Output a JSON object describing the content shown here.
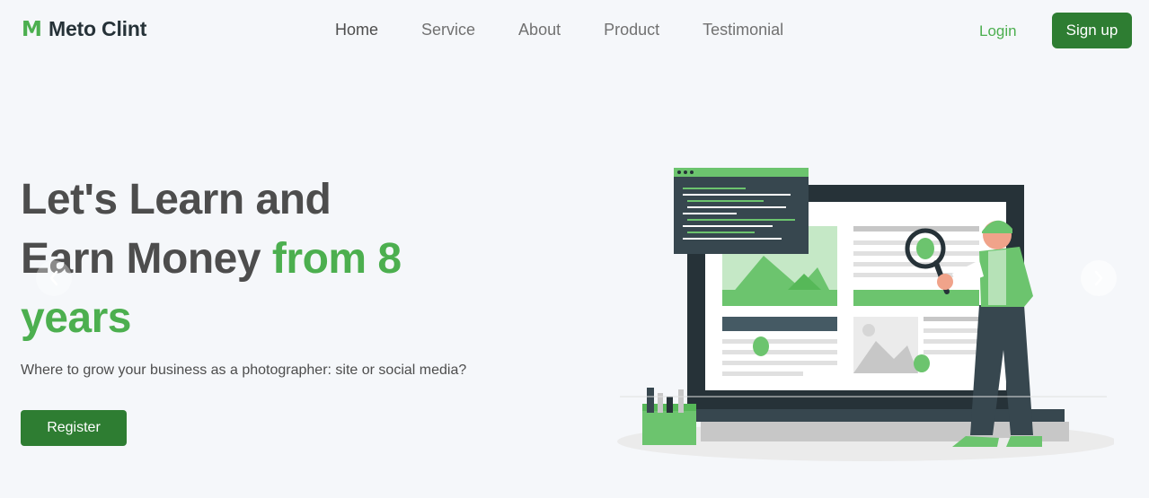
{
  "brand": {
    "logo_letter": "M",
    "name": "Meto Clint",
    "accent_color": "#4caf4f",
    "dark_green": "#2e7d32"
  },
  "nav": {
    "items": [
      {
        "label": "Home",
        "active": true
      },
      {
        "label": "Service",
        "active": false
      },
      {
        "label": "About",
        "active": false
      },
      {
        "label": "Product",
        "active": false
      },
      {
        "label": "Testimonial",
        "active": false
      }
    ]
  },
  "auth": {
    "login_label": "Login",
    "signup_label": "Sign up"
  },
  "hero": {
    "title_line1": "Let's Learn and",
    "title_line2_plain": "Earn Money ",
    "title_line2_accent": "from 8",
    "title_line3_accent": "years",
    "subtitle": "Where to grow your business as a photographer: site or social media?",
    "cta_label": "Register"
  },
  "carousel": {
    "prev_icon": "chevron-left-icon",
    "next_icon": "chevron-right-icon"
  },
  "illustration": {
    "name": "debugging-illustration"
  }
}
